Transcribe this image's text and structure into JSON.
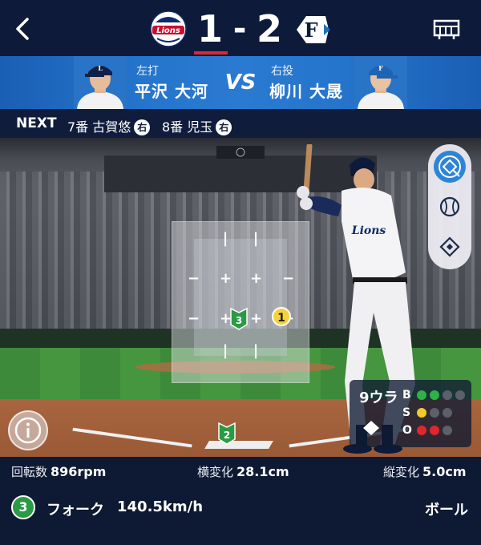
{
  "header": {
    "back_icon": "chevron-left-icon",
    "home_team_logo": "Lions",
    "home_score": "1",
    "dash": "-",
    "away_score": "2",
    "away_team_logo": "F",
    "scoreboard_icon": "scoreboard-icon"
  },
  "matchup": {
    "batter_side": "左打",
    "batter_name": "平沢 大河",
    "vs": "VS",
    "pitcher_side": "右投",
    "pitcher_name": "柳川 大晟"
  },
  "next": {
    "label": "NEXT",
    "batters": [
      {
        "order": "7番 古賀悠",
        "hand": "右"
      },
      {
        "order": "8番 児玉",
        "hand": "右"
      }
    ]
  },
  "field": {
    "pitch_markers": [
      {
        "number": "3",
        "color": "#2b9a44"
      },
      {
        "number": "2",
        "color": "#2b9a44"
      },
      {
        "number": "1",
        "color": "#f4d23a"
      }
    ],
    "view_buttons": [
      {
        "name": "pitch-view-icon",
        "active": true
      },
      {
        "name": "ball-view-icon",
        "active": false
      },
      {
        "name": "field-view-icon",
        "active": false
      }
    ],
    "info_icon": "info-icon"
  },
  "count": {
    "inning": "9ウラ",
    "ball_label": "B",
    "strike_label": "S",
    "out_label": "O",
    "balls": 2,
    "strikes": 1,
    "outs": 2,
    "bases_icon": "bases-diamond-icon"
  },
  "pitch": {
    "spin_label": "回転数",
    "spin_value": "896rpm",
    "hbreak_label": "横変化",
    "hbreak_value": "28.1cm",
    "vbreak_label": "縦変化",
    "vbreak_value": "5.0cm",
    "number": "3",
    "type": "フォーク",
    "speed": "140.5km/h",
    "result": "ボール"
  },
  "colors": {
    "navy": "#0d1a3a",
    "matchup_blue": "#2575cc",
    "ball_green": "#30b04a",
    "strike_yellow": "#f2c928",
    "out_red": "#e0262f"
  }
}
